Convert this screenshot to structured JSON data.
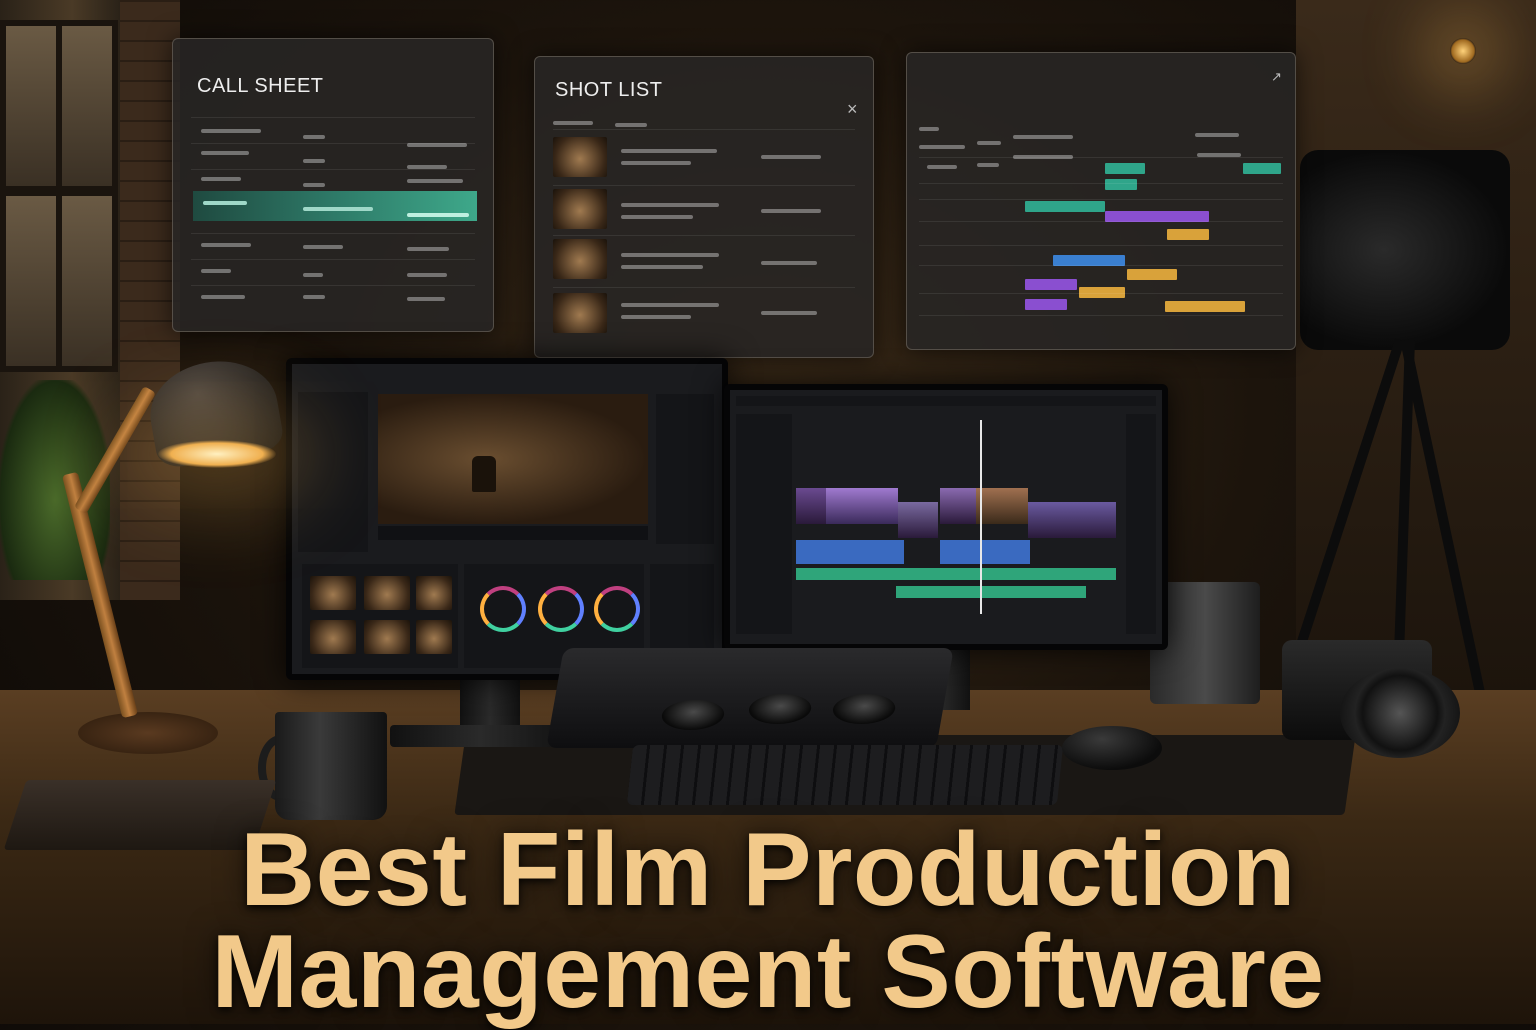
{
  "panels": {
    "call_sheet": {
      "title": "CALL SHEET"
    },
    "shot_list": {
      "title": "SHOT LIST",
      "close_glyph": "×"
    },
    "schedule": {
      "close_glyph": "↗"
    }
  },
  "headline": {
    "line1": "Best Film Production",
    "line2": "Management Software",
    "color": "#f2c98a"
  },
  "colors": {
    "timeline_teal": "#2fa58a",
    "timeline_purple": "#8a4fd0",
    "timeline_gold": "#d9a23a",
    "timeline_blue": "#3a7fd0"
  }
}
